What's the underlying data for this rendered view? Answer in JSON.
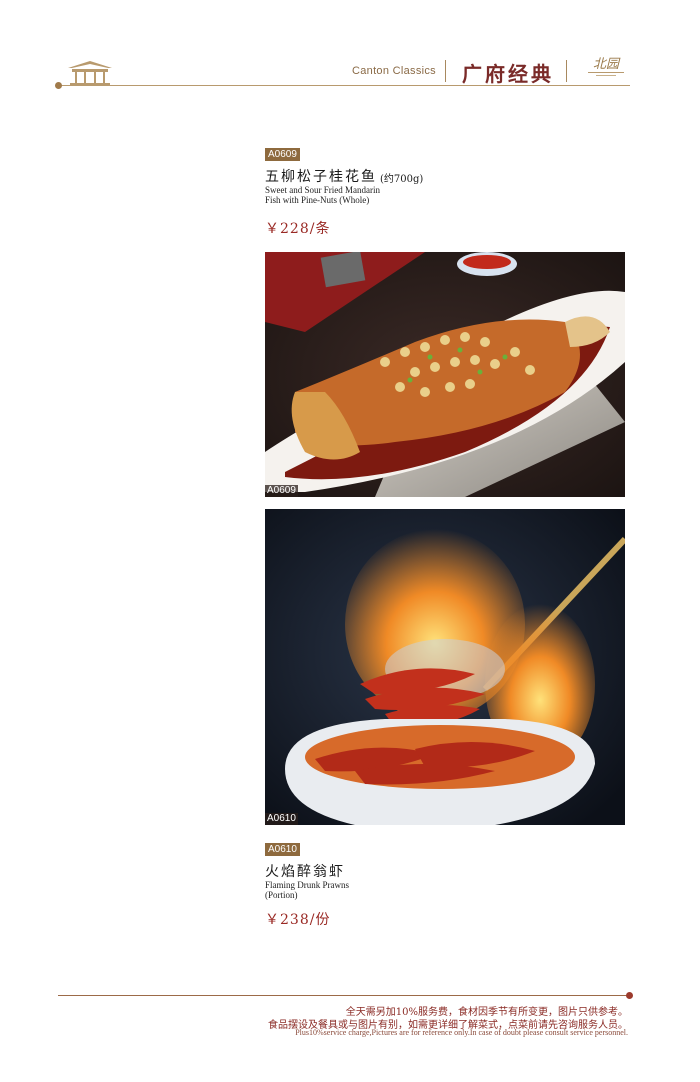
{
  "header": {
    "section_en": "Canton Classics",
    "section_cn": "广府经典",
    "brand_glyph": "北园"
  },
  "dishes": [
    {
      "code": "A0609",
      "name_cn": "五柳松子桂花鱼",
      "weight": "(约700g)",
      "name_en_line1": "Sweet and Sour Fried Mandarin",
      "name_en_line2": "Fish with Pine-Nuts   (Whole)",
      "price": "￥228/条",
      "photo_code": "A0609"
    },
    {
      "code": "A0610",
      "name_cn": "火焰醉翁虾",
      "name_en_line1": "Flaming Drunk Prawns",
      "name_en_line2": "(Portion)",
      "price": "￥238/份",
      "photo_code": "A0610"
    }
  ],
  "footer": {
    "line1": "全天需另加10%服务费，食材因季节有所变更，图片只供参考。",
    "line2": "食品摆设及餐具或与图片有别，如需更详细了解菜式，点菜前请先咨询服务人员。",
    "line3": "Plus10%service charge,Pictures are for reference only.In case of doubt please consult service personnel."
  }
}
